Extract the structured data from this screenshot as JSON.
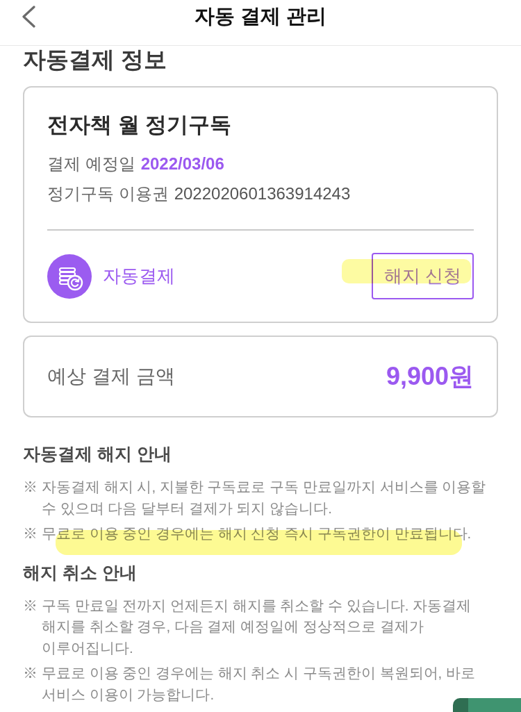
{
  "header": {
    "title": "자동 결제 관리"
  },
  "info_section": {
    "title": "자동결제 정보",
    "subscription_card": {
      "name": "전자책 월 정기구독",
      "details": [
        {
          "label": "결제 예정일",
          "value": "2022/03/06",
          "emphasis": true
        },
        {
          "label": "정기구독 이용권",
          "value": "2022020601363914243",
          "emphasis": false
        }
      ],
      "payment_method": "자동결제",
      "cancel_button": {
        "label": "해지 신청",
        "highlighted": true
      }
    },
    "amount_card": {
      "label": "예상 결제 금액",
      "value": "9,900원"
    }
  },
  "notices": [
    {
      "title": "자동결제 해지 안내",
      "items": [
        {
          "mark": "※",
          "text": "자동결제 해지 시, 지불한 구독료로 구독 만료일까지 서비스를 이용할 수 있으며 다음 달부터 결제가 되지 않습니다.",
          "highlighted": false
        },
        {
          "mark": "※",
          "text": "무료로 이용 중인 경우에는 해지 신청 즉시 구독권한이 만료됩니다.",
          "highlighted": true
        }
      ]
    },
    {
      "title": "해지 취소 안내",
      "items": [
        {
          "mark": "※",
          "text": "구독 만료일 전까지 언제든지 해지를 취소할 수 있습니다. 자동결제 해지를 취소할 경우, 다음 결제 예정일에 정상적으로 결제가 이루어집니다.",
          "highlighted": false
        },
        {
          "mark": "※",
          "text": "무료로 이용 중인 경우에는 해지 취소 시 구독권한이 복원되어, 바로 서비스 이용이 가능합니다.",
          "highlighted": false
        }
      ]
    }
  ],
  "floating_button": {
    "shown": true
  }
}
